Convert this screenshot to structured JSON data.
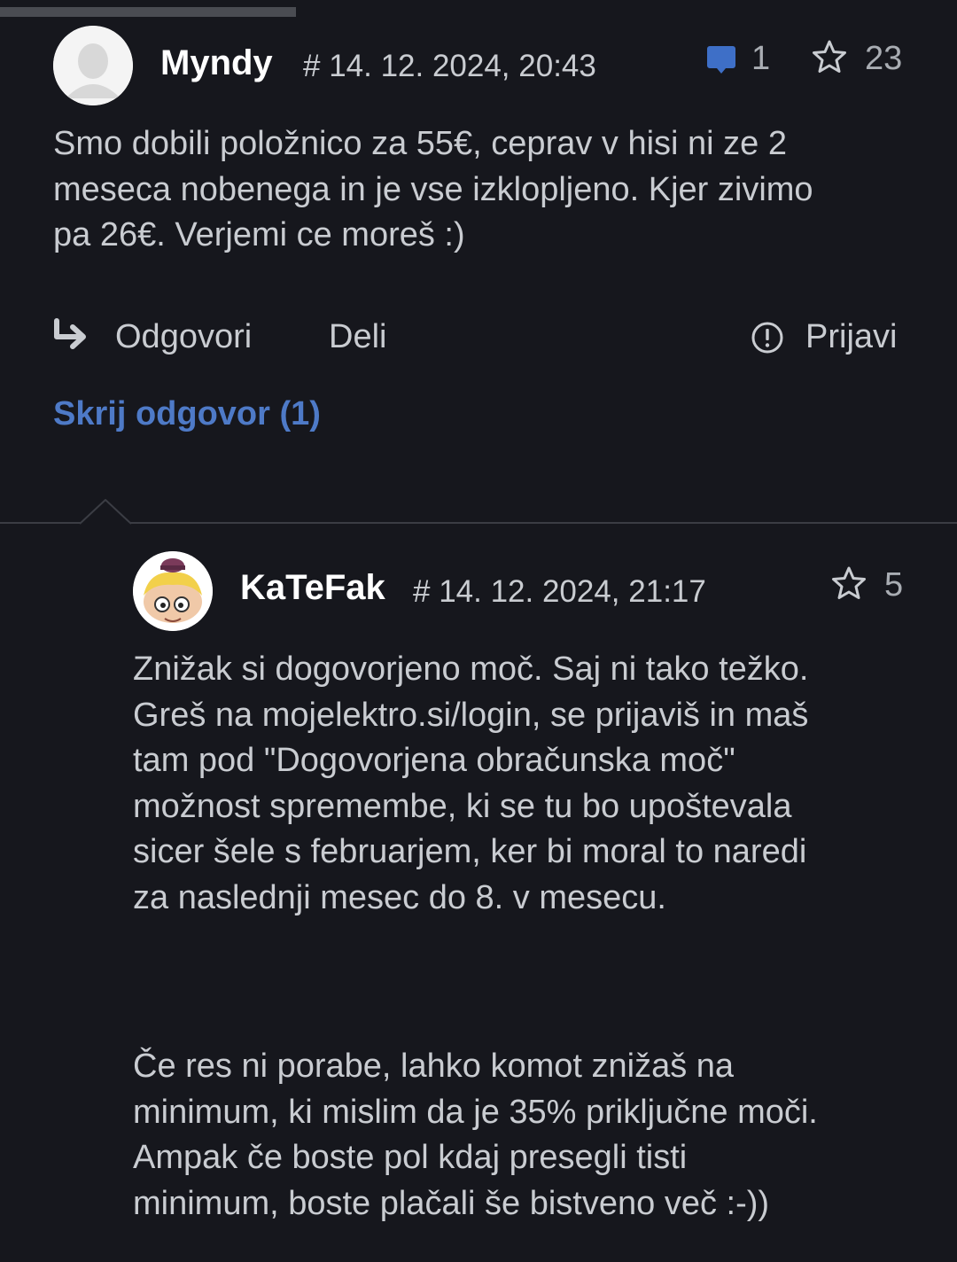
{
  "colors": {
    "background": "#16171d",
    "text": "#c9ccd1",
    "accent": "#4e7ac7",
    "username": "#ffffff"
  },
  "comments": [
    {
      "author": "Myndy",
      "timestamp": "# 14. 12. 2024, 20:43",
      "reply_count": "1",
      "favorites": "23",
      "avatar_icon": "default-user-avatar",
      "body": "Smo dobili položnico za 55€, ceprav v hisi ni ze 2\nmeseca nobenega in je vse izklopljeno. Kjer zivimo\npa 26€. Verjemi ce moreš :)",
      "actions": {
        "reply": "Odgovori",
        "share": "Deli",
        "report": "Prijavi"
      },
      "toggle_replies": "Skrij odgovor (1)"
    },
    {
      "author": "KaTeFak",
      "timestamp": "# 14. 12. 2024, 21:17",
      "favorites": "5",
      "avatar_icon": "cartoon-avatar",
      "body_p1": "Znižak si dogovorjeno moč. Saj ni tako težko.\nGreš na mojelektro.si/login, se prijaviš in maš\ntam pod \"Dogovorjena obračunska moč\"\nmožnost spremembe, ki se tu bo upoštevala\nsicer šele s februarjem, ker bi moral to naredi\nza naslednji mesec do 8. v mesecu.",
      "body_p2": "Če res ni porabe, lahko komot znižaš na\nminimum, ki mislim da je 35% priključne moči.\nAmpak če boste pol kdaj presegli tisti\nminimum, boste plačali še bistveno več :-))"
    }
  ]
}
